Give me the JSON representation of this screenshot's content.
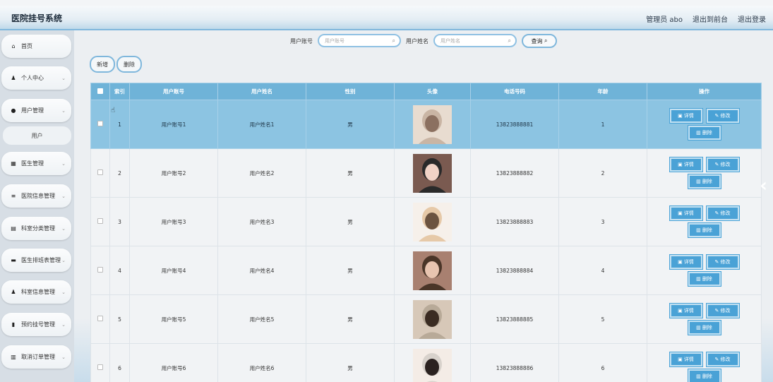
{
  "app": {
    "title": "医院挂号系统"
  },
  "header": {
    "user": "管理员 abo",
    "to_front": "退出到前台",
    "logout": "退出登录"
  },
  "sidebar": {
    "items": [
      {
        "icon": "home-icon",
        "glyph": "⌂",
        "label": "首页",
        "chevron": false
      },
      {
        "icon": "user-icon",
        "glyph": "♟",
        "label": "个人中心",
        "chevron": true
      },
      {
        "icon": "pin-icon",
        "glyph": "●",
        "label": "用户管理",
        "chevron": true
      },
      {
        "icon": "grid-icon",
        "glyph": "▦",
        "label": "医生管理",
        "chevron": true
      },
      {
        "icon": "list-icon",
        "glyph": "≡",
        "label": "医院信息管理",
        "chevron": true
      },
      {
        "icon": "chart-icon",
        "glyph": "▤",
        "label": "科室分类管理",
        "chevron": true
      },
      {
        "icon": "printer-icon",
        "glyph": "▬",
        "label": "医生排班表管理",
        "chevron": true
      },
      {
        "icon": "person-icon",
        "glyph": "♟",
        "label": "科室信息管理",
        "chevron": true
      },
      {
        "icon": "phone-icon",
        "glyph": "▮",
        "label": "预约挂号管理",
        "chevron": true
      },
      {
        "icon": "doc-icon",
        "glyph": "▥",
        "label": "取消订单管理",
        "chevron": true
      }
    ],
    "submenu": {
      "label": "用户"
    }
  },
  "search": {
    "account_label": "用户账号",
    "account_placeholder": "用户账号",
    "name_label": "用户姓名",
    "name_placeholder": "用户姓名",
    "query_label": "查询"
  },
  "toolbar": {
    "add_label": "新增",
    "delete_label": "删除"
  },
  "table": {
    "headers": [
      "索引",
      "用户账号",
      "用户姓名",
      "性别",
      "头像",
      "电话号码",
      "年龄",
      "操作"
    ],
    "actions": {
      "detail": "详情",
      "edit": "修改",
      "delete": "删除"
    },
    "rows": [
      {
        "index": "1",
        "account": "用户账号1",
        "name": "用户姓名1",
        "gender": "男",
        "phone": "13823888881",
        "age": "1"
      },
      {
        "index": "2",
        "account": "用户账号2",
        "name": "用户姓名2",
        "gender": "男",
        "phone": "13823888882",
        "age": "2"
      },
      {
        "index": "3",
        "account": "用户账号3",
        "name": "用户姓名3",
        "gender": "男",
        "phone": "13823888883",
        "age": "3"
      },
      {
        "index": "4",
        "account": "用户账号4",
        "name": "用户姓名4",
        "gender": "男",
        "phone": "13823888884",
        "age": "4"
      },
      {
        "index": "5",
        "account": "用户账号5",
        "name": "用户姓名5",
        "gender": "男",
        "phone": "13823888885",
        "age": "5"
      },
      {
        "index": "6",
        "account": "用户账号6",
        "name": "用户姓名6",
        "gender": "男",
        "phone": "13823888886",
        "age": "6"
      }
    ]
  },
  "colors": {
    "accent": "#6fb3d8",
    "selected_row": "#8cc4e2",
    "button": "#4aa2d6"
  }
}
